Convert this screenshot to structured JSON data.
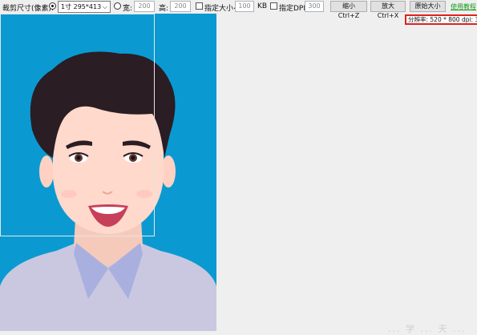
{
  "toolbar": {
    "crop_size_label": "裁剪尺寸(像素):",
    "preset_select_value": "1寸  295*413",
    "width_label": "宽:",
    "width_value": "200",
    "height_label": "高:",
    "height_value": "200",
    "size_limit_label": "指定大小<",
    "size_limit_value": "100",
    "size_unit": "KB",
    "dpi_label": "指定DPI:",
    "dpi_value": "300",
    "zoom_out_label": "缩小 Ctrl+Z",
    "zoom_in_label": "放大 Ctrl+X",
    "original_size_label": "原始大小",
    "tutorial_link": "使用教程"
  },
  "resolution_text": "分辨率: 520 * 800 dpi: 300",
  "watermark_text": "... 学 ... 天 ...",
  "colors": {
    "background": "#0a9ad1",
    "hair": "#2a1d24",
    "skin": "#ffd9cb",
    "shirt": "#c9c8e0",
    "collar": "#a9b0e0",
    "highlight_border": "#e02020",
    "link": "#1a9a1a"
  }
}
